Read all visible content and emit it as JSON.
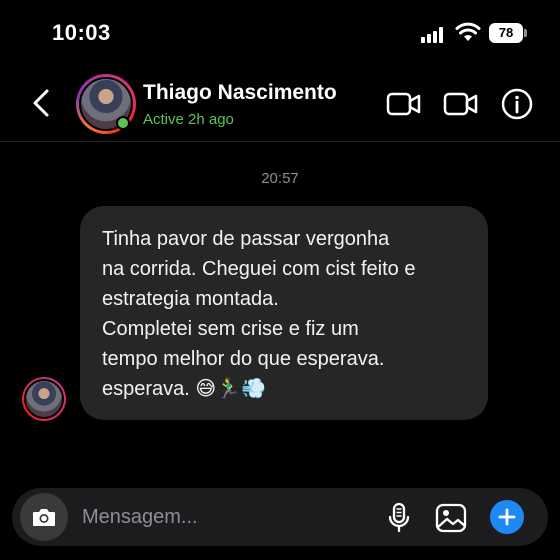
{
  "status_bar": {
    "time": "10:03",
    "battery_level": "78",
    "icons": [
      "signal-icon",
      "wifi-icon",
      "battery-icon"
    ]
  },
  "header": {
    "contact_name": "Thiago Nascimento",
    "contact_status": "Active 2h ago",
    "icons": [
      "back-chevron-icon",
      "audio-call-icon",
      "video-call-icon",
      "info-icon"
    ]
  },
  "conversation": {
    "timestamp": "20:57",
    "message": {
      "lines": [
        "Tinha pavor de passar vergonha",
        "na corrida. Cheguei com cist feito e",
        "estrategia montada.",
        "Completei sem crise e fiz um",
        "tempo melhor do que esperava.",
        "esperava. 😅🏃‍♂️💨"
      ]
    }
  },
  "composer": {
    "placeholder": "Mensagem...",
    "icons": [
      "camera-icon",
      "microphone-icon",
      "gallery-icon",
      "plus-icon"
    ]
  },
  "colors": {
    "background": "#000000",
    "bubble": "#262626",
    "active_green": "#5cc15c",
    "accent_blue": "#1e88f5",
    "muted_text": "#8e8e93"
  }
}
